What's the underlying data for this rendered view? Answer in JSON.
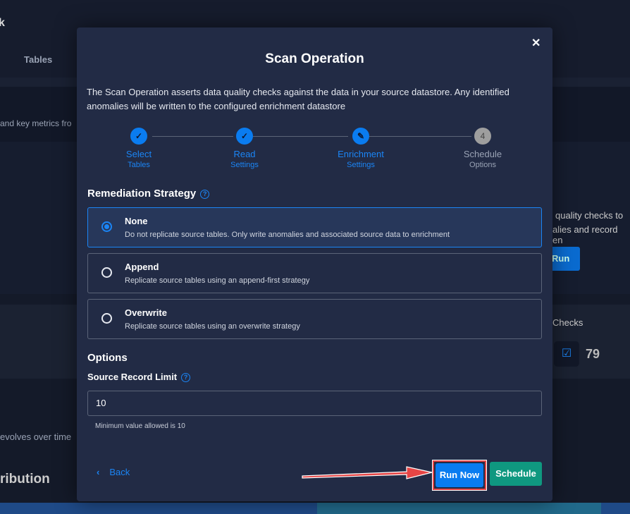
{
  "background": {
    "tab": "Tables",
    "text1": "and key metrics fro",
    "text2": "quality checks to",
    "text3": "alies and record en",
    "run": "Run",
    "checks_label": "Checks",
    "checks_count": "79",
    "text4": "evolves over time",
    "heading": "ribution",
    "corner": "k"
  },
  "modal": {
    "title": "Scan Operation",
    "close_icon": "x-icon",
    "description": "The Scan Operation asserts data quality checks against the data in your source datastore. Any identified anomalies will be written to the configured enrichment datastore",
    "steps": [
      {
        "line1": "Select",
        "line2": "Tables",
        "state": "done"
      },
      {
        "line1": "Read",
        "line2": "Settings",
        "state": "done"
      },
      {
        "line1": "Enrichment",
        "line2": "Settings",
        "state": "current"
      },
      {
        "line1": "Schedule",
        "line2": "Options",
        "state": "pending",
        "number": "4"
      }
    ],
    "remediation": {
      "heading": "Remediation Strategy",
      "options": [
        {
          "title": "None",
          "desc": "Do not replicate source tables. Only write anomalies and associated source data to enrichment",
          "selected": true
        },
        {
          "title": "Append",
          "desc": "Replicate source tables using an append-first strategy",
          "selected": false
        },
        {
          "title": "Overwrite",
          "desc": "Replicate source tables using an overwrite strategy",
          "selected": false
        }
      ]
    },
    "options": {
      "heading": "Options",
      "source_record_limit_label": "Source Record Limit",
      "source_record_limit_value": "10",
      "hint": "Minimum value allowed is 10"
    },
    "footer": {
      "back": "Back",
      "run_now": "Run Now",
      "schedule": "Schedule"
    }
  },
  "colors": {
    "accent": "#0a7cf0",
    "schedule": "#0f9880",
    "highlight": "#e64545"
  }
}
